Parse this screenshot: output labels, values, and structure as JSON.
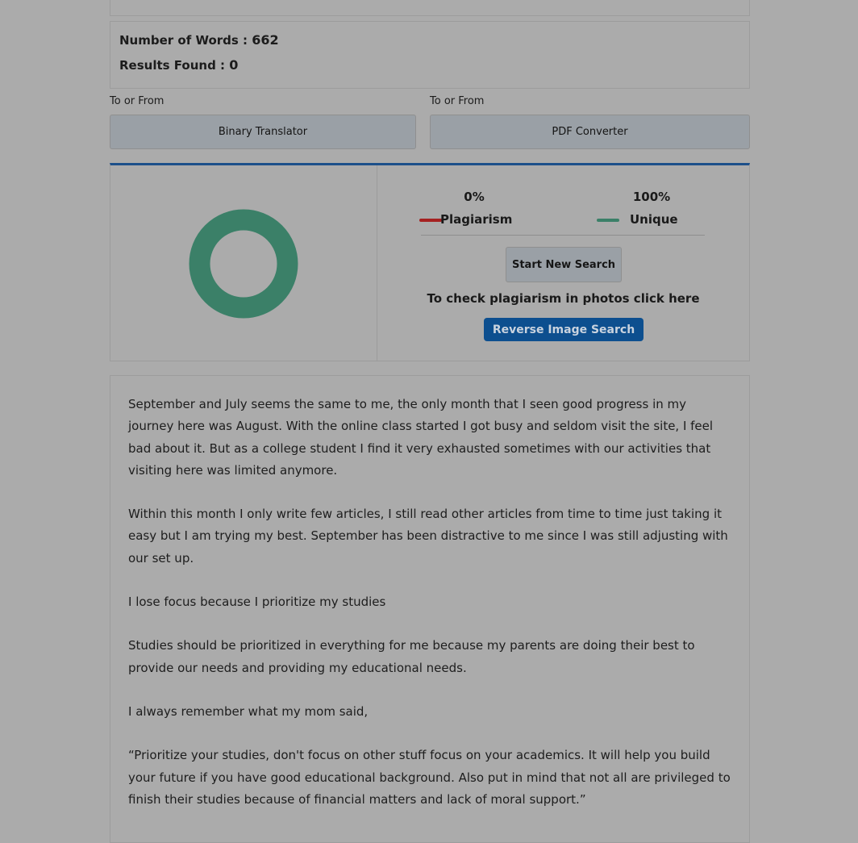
{
  "stats": {
    "words_label": "Number of Words : ",
    "words_value": "662",
    "results_label": "Results Found : ",
    "results_value": "0"
  },
  "tools": [
    {
      "caption": "To or From",
      "label": "Binary Translator"
    },
    {
      "caption": "To or From",
      "label": "PDF Converter"
    }
  ],
  "result": {
    "plagiarism_pct": "0%",
    "plagiarism_label": "Plagiarism",
    "unique_pct": "100%",
    "unique_label": "Unique",
    "plagiarism_color": "#a52121",
    "unique_color": "#3b8068",
    "start_label": "Start New Search",
    "photo_text": "To check plagiarism in photos click here",
    "reverse_label": "Reverse Image Search",
    "unique_fraction": 1.0
  },
  "article": {
    "paragraphs": [
      "September and July seems the same to me, the only month that I seen good progress in my journey here was August. With the online class started I got busy and seldom visit the site, I feel bad about it. But as a college student I find it very exhausted sometimes with our activities that visiting here was limited anymore.",
      "Within this month I only write few articles, I still read other articles from time to time just taking it easy but I am trying my best. September has been distractive to me since I was still adjusting with our set up.",
      "I lose focus because I prioritize my studies",
      "Studies should be prioritized in everything for me because my parents are doing their best to provide our needs and providing my educational needs.",
      "I always remember what my mom said,",
      "“Prioritize your studies, don't focus on other stuff focus on your academics. It will help you build your future if you have good educational background. Also put in mind that not all are privileged to finish their studies because of financial matters and lack of moral support.”"
    ]
  }
}
